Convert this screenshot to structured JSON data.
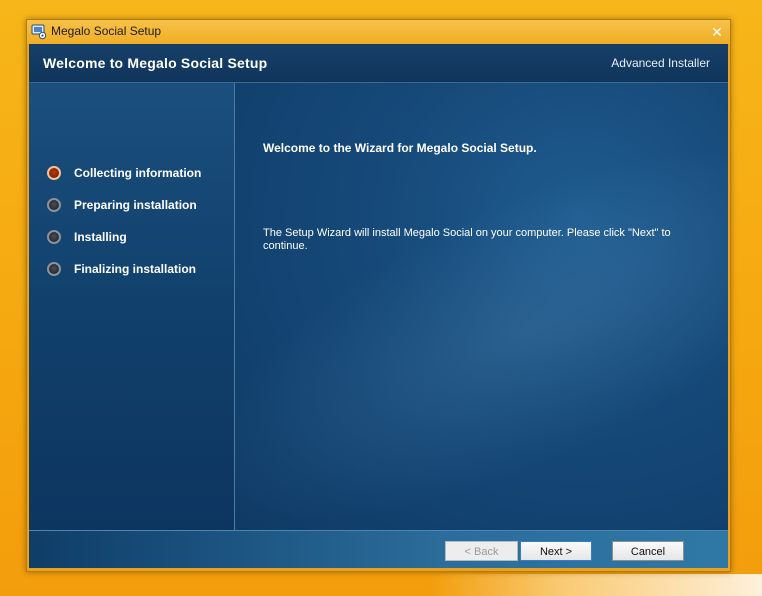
{
  "window": {
    "title": "Megalo Social Setup",
    "close_glyph": "✕"
  },
  "header": {
    "title": "Welcome to Megalo Social Setup",
    "brand": "Advanced Installer"
  },
  "steps": [
    {
      "label": "Collecting information",
      "state": "active"
    },
    {
      "label": "Preparing installation",
      "state": "pending"
    },
    {
      "label": "Installing",
      "state": "pending"
    },
    {
      "label": "Finalizing installation",
      "state": "pending"
    }
  ],
  "main": {
    "heading": "Welcome to the Wizard for Megalo Social Setup.",
    "body": "The Setup Wizard will install Megalo Social on your computer.  Please click \"Next\" to continue."
  },
  "buttons": {
    "back": "< Back",
    "next": "Next >",
    "cancel": "Cancel"
  },
  "colors": {
    "desktop": "#f5a70f",
    "panel_dark": "#0f3a66",
    "active_step": "#b33a08"
  },
  "icons": {
    "app": "monitor-gear-icon",
    "close": "close-icon",
    "active_step": "orange-bullet-icon",
    "pending_step": "gray-bullet-icon"
  }
}
